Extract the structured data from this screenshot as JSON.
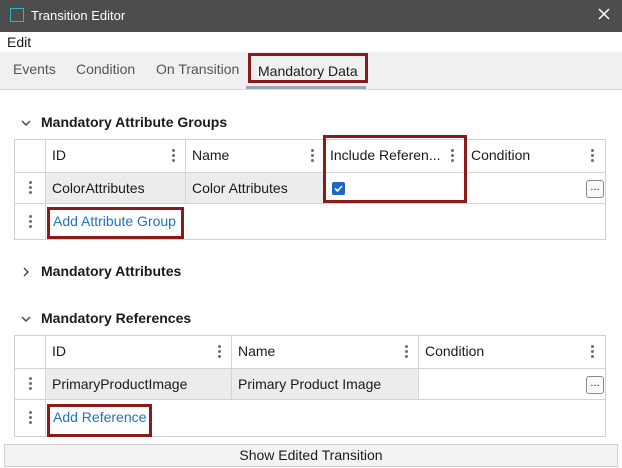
{
  "window": {
    "title": "Transition Editor",
    "app_icon": "window-icon",
    "close_icon": "close-icon"
  },
  "menu": {
    "edit": "Edit"
  },
  "tabs": [
    {
      "label": "Events"
    },
    {
      "label": "Condition"
    },
    {
      "label": "On Transition"
    },
    {
      "label": "Mandatory Data",
      "selected": true
    }
  ],
  "sections": {
    "attribute_groups": {
      "title": "Mandatory Attribute Groups",
      "expanded": true,
      "columns": [
        "ID",
        "Name",
        "Include Referen...",
        "Condition"
      ],
      "rows": [
        {
          "id": "ColorAttributes",
          "name": "Color Attributes",
          "include_references": true,
          "condition": ""
        }
      ],
      "add_label": "Add Attribute Group"
    },
    "attributes": {
      "title": "Mandatory Attributes",
      "expanded": false
    },
    "references": {
      "title": "Mandatory References",
      "expanded": true,
      "columns": [
        "ID",
        "Name",
        "Condition"
      ],
      "rows": [
        {
          "id": "PrimaryProductImage",
          "name": "Primary Product Image",
          "condition": ""
        }
      ],
      "add_label": "Add Reference"
    }
  },
  "ellipsis_label": "...",
  "footer": {
    "button_label": "Show Edited Transition"
  },
  "colors": {
    "titlebar": "#4d4d4d",
    "highlight": "#8b1a1a",
    "link": "#1e73be",
    "checkbox": "#1e66c2"
  }
}
